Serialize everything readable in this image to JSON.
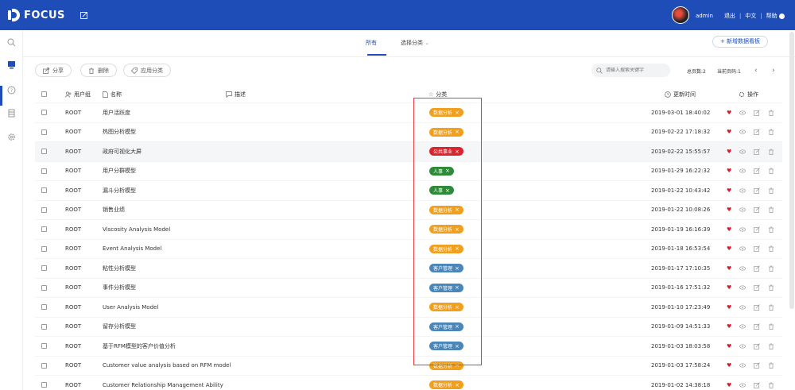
{
  "app": {
    "logo_text": "FOCUS",
    "user": "admin",
    "logout": "退出",
    "lang": "中文",
    "help": "帮助",
    "sep": "|"
  },
  "tabs": [
    {
      "label": "所有",
      "active": true
    },
    {
      "label": "选择分类",
      "active": false
    }
  ],
  "add_button": "+ 新增数据看板",
  "toolbar": {
    "share": "分享",
    "delete": "删除",
    "apply_category": "应用分类"
  },
  "search": {
    "placeholder": "请输入搜索关键字"
  },
  "pagination": {
    "total": "总页数:2",
    "current": "当前页码:1"
  },
  "table": {
    "headers": {
      "group": "用户组",
      "name": "名称",
      "desc": "描述",
      "category": "分类",
      "time": "更新时间",
      "action": "操作"
    },
    "rows": [
      {
        "group": "ROOT",
        "name": "用户活跃度",
        "tag": "数据分析",
        "tag_color": "#f0a01e",
        "time": "2019-03-01 18:40:02"
      },
      {
        "group": "ROOT",
        "name": "热图分析模型",
        "tag": "数据分析",
        "tag_color": "#f0a01e",
        "time": "2019-02-22 17:18:32"
      },
      {
        "group": "ROOT",
        "name": "政府可视化大屏",
        "tag": "公共事业",
        "tag_color": "#d9262e",
        "time": "2019-02-22 15:55:57"
      },
      {
        "group": "ROOT",
        "name": "用户分群模型",
        "tag": "人事",
        "tag_color": "#2e8b3a",
        "time": "2019-01-29 16:22:32"
      },
      {
        "group": "ROOT",
        "name": "漏斗分析模型",
        "tag": "人事",
        "tag_color": "#2e8b3a",
        "time": "2019-01-22 10:43:42"
      },
      {
        "group": "ROOT",
        "name": "销售业绩",
        "tag": "数据分析",
        "tag_color": "#f0a01e",
        "time": "2019-01-22 10:08:26"
      },
      {
        "group": "ROOT",
        "name": "Viscosity Analysis Model",
        "tag": "数据分析",
        "tag_color": "#f0a01e",
        "time": "2019-01-19 16:16:39"
      },
      {
        "group": "ROOT",
        "name": "Event Analysis Model",
        "tag": "数据分析",
        "tag_color": "#f0a01e",
        "time": "2019-01-18 16:53:54"
      },
      {
        "group": "ROOT",
        "name": "粘性分析模型",
        "tag": "客户管理",
        "tag_color": "#4a86b8",
        "time": "2019-01-17 17:10:35"
      },
      {
        "group": "ROOT",
        "name": "事件分析模型",
        "tag": "客户管理",
        "tag_color": "#4a86b8",
        "time": "2019-01-16 17:51:32"
      },
      {
        "group": "ROOT",
        "name": "User Analysis Model",
        "tag": "数据分析",
        "tag_color": "#f0a01e",
        "time": "2019-01-10 17:23:49"
      },
      {
        "group": "ROOT",
        "name": "留存分析模型",
        "tag": "客户管理",
        "tag_color": "#4a86b8",
        "time": "2019-01-09 14:51:33"
      },
      {
        "group": "ROOT",
        "name": "基于RFM模型的客户价值分析",
        "tag": "客户管理",
        "tag_color": "#4a86b8",
        "time": "2019-01-03 18:03:58"
      },
      {
        "group": "ROOT",
        "name": "Customer value analysis based on RFM model",
        "tag": "数据分析",
        "tag_color": "#f0a01e",
        "time": "2019-01-03 17:58:24"
      },
      {
        "group": "ROOT",
        "name": "Customer Relationship Management Ability",
        "tag": "数据分析",
        "tag_color": "#f0a01e",
        "time": "2019-01-02 14:38:18"
      }
    ]
  },
  "colors": {
    "brand": "#1f4db7",
    "highlight_box": "#e43b3b"
  }
}
